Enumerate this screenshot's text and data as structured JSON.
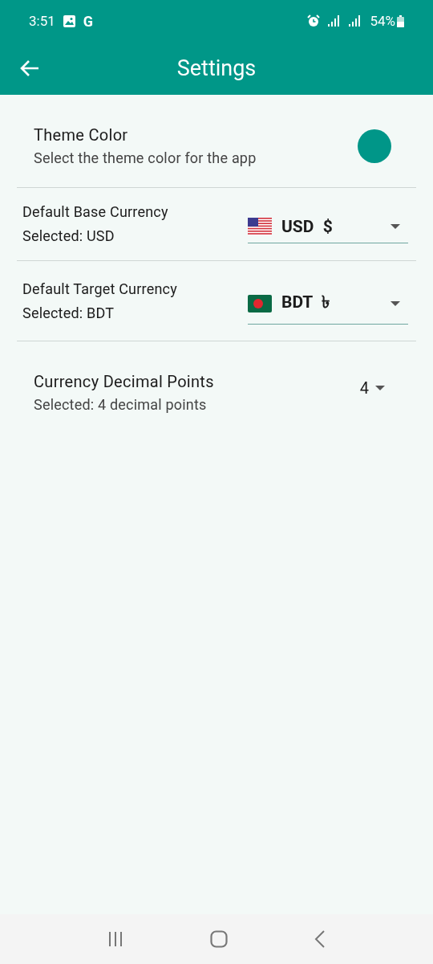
{
  "status_bar": {
    "time": "3:51",
    "notification": "G",
    "battery": "54%"
  },
  "app_bar": {
    "title": "Settings"
  },
  "settings": [
    {
      "kind": "color",
      "title": "Theme Color",
      "subtitle": "Select the theme color for the app",
      "color": "#009688"
    },
    {
      "kind": "currency",
      "title": "Default Base Currency",
      "subtitle": "Selected: USD",
      "flag": {
        "kind": "us"
      },
      "value": "USD",
      "symbol": "$"
    },
    {
      "kind": "currency",
      "title": "Default Target Currency",
      "subtitle": "Selected: BDT",
      "flag": {
        "kind": "bd"
      },
      "value": "BDT",
      "symbol": "৳"
    },
    {
      "kind": "decimal",
      "title": "Currency Decimal Points",
      "subtitle": "Selected: 4 decimal points",
      "value": "4"
    }
  ]
}
